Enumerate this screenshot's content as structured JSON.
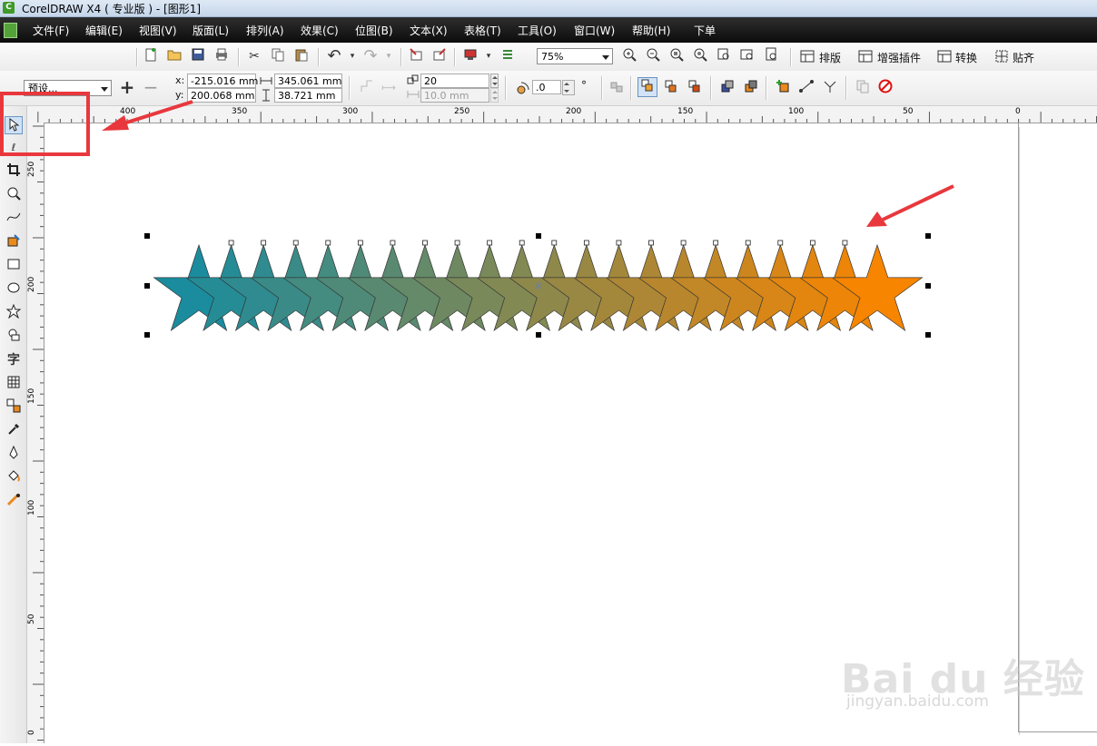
{
  "window": {
    "title": "CorelDRAW X4 ( 专业版 ) - [图形1]"
  },
  "menu": [
    "文件(F)",
    "编辑(E)",
    "视图(V)",
    "版面(L)",
    "排列(A)",
    "效果(C)",
    "位图(B)",
    "文本(X)",
    "表格(T)",
    "工具(O)",
    "窗口(W)",
    "帮助(H)",
    "下单"
  ],
  "toolbar": {
    "zoom": "75%",
    "plugins": [
      "排版",
      "增强插件",
      "转换",
      "贴齐"
    ]
  },
  "property_bar": {
    "preset": "预设...",
    "x_label": "x:",
    "y_label": "y:",
    "x": "-215.016 mm",
    "y": "200.068 mm",
    "width": "345.061 mm",
    "height": "38.721 mm",
    "steps": "20",
    "spacing": "10.0 mm",
    "rotation": ".0",
    "degree": "°"
  },
  "ruler": {
    "h_labels": [
      "400",
      "350",
      "300",
      "250",
      "200",
      "150",
      "100",
      "50",
      "0"
    ],
    "v_labels": [
      "250",
      "200",
      "150",
      "100",
      "50",
      "0"
    ]
  },
  "blend": {
    "star_count": 22,
    "start_color": "#1a8c9e",
    "end_color": "#f78500"
  },
  "colors": {
    "annotation_red": "#e8383d",
    "menubar_bg": "#161616"
  },
  "watermark": {
    "main": "Bai du 经验",
    "sub": "jingyan.baidu.com"
  }
}
